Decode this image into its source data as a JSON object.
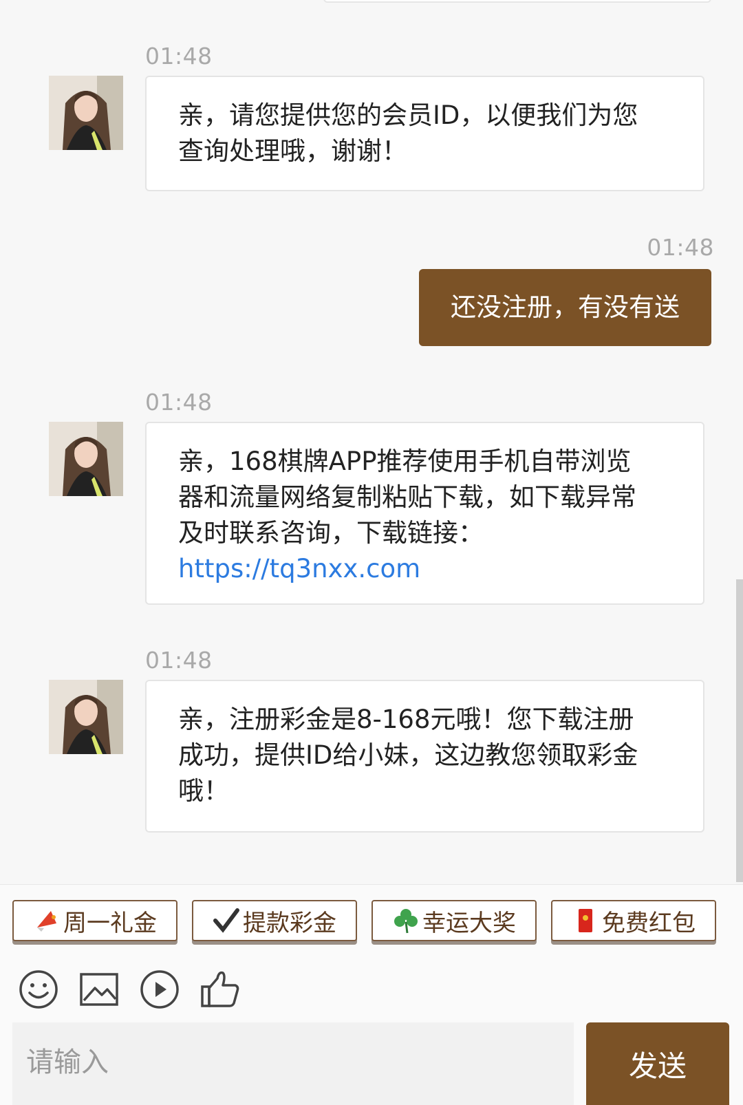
{
  "messages": [
    {
      "time": "01:48",
      "from": "agent",
      "lines": [
        "亲，请您提供您的会员ID，以便我们为您",
        "查询处理哦，谢谢！"
      ]
    },
    {
      "time": "01:48",
      "from": "user",
      "text": "还没注册，有没有送"
    },
    {
      "time": "01:48",
      "from": "agent",
      "lines": [
        "亲，168棋牌APP推荐使用手机自带浏览",
        "器和流量网络复制粘贴下载，如下载异常",
        "及时联系咨询，下载链接："
      ],
      "link": "https://tq3nxx.com"
    },
    {
      "time": "01:48",
      "from": "agent",
      "lines": [
        "亲，注册彩金是8-168元哦！您下载注册",
        "成功，提供ID给小妹，这边教您领取彩金",
        "哦！"
      ]
    }
  ],
  "quick_buttons": [
    {
      "label": "周一礼金",
      "icon": "megaphone-icon"
    },
    {
      "label": "提款彩金",
      "icon": "checkmark-icon"
    },
    {
      "label": "幸运大奖",
      "icon": "shamrock-icon"
    },
    {
      "label": "免费红包",
      "icon": "red-envelope-icon"
    }
  ],
  "toolbar": [
    "emoji-icon",
    "image-icon",
    "video-icon",
    "thumbs-up-icon"
  ],
  "input": {
    "placeholder": "请输入"
  },
  "send_label": "发送",
  "colors": {
    "accent": "#7b5226",
    "link": "#2c7be0",
    "background": "#f7f7f7"
  }
}
